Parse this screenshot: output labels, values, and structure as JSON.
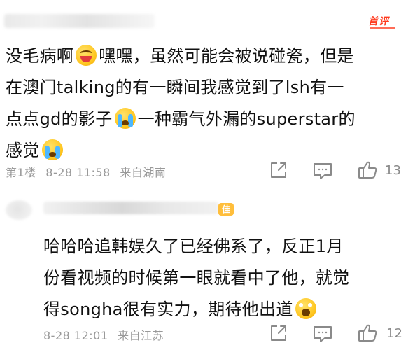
{
  "header": {
    "hot_tag": "首评"
  },
  "comments": [
    {
      "lines": [
        [
          "没毛病啊",
          "嘿嘿，虽然可能会被说碰瓷，但是"
        ],
        [
          "在澳门talking的有一瞬间我感觉到了lsh有一"
        ],
        [
          "点点gd的影子",
          "一种霸气外漏的superstar的"
        ],
        [
          "感觉"
        ]
      ],
      "emojis": [
        "laugh-emoji",
        "crying-emoji",
        "crying-emoji"
      ],
      "floor": "第1楼",
      "date": "8-28 11:58",
      "location": "来自湖南",
      "likes": "13"
    },
    {
      "level_badge": "佳",
      "lines": [
        [
          "哈哈哈追韩娱久了已经佛系了，反正1月"
        ],
        [
          "份看视频的时候第一眼就看中了他，就觉"
        ],
        [
          "得songha很有实力，期待他出道"
        ]
      ],
      "emojis": [
        "screaming-emoji"
      ],
      "date": "8-28 12:01",
      "location": "来自江苏",
      "likes": "12"
    }
  ],
  "icons": {
    "share": "share-icon",
    "reply": "comment-icon",
    "like": "thumbs-up-icon"
  },
  "colors": {
    "hot_tag": "#ff3b1f",
    "meta_text": "#999999",
    "text": "#111111",
    "badge": "#ffbe3b"
  }
}
